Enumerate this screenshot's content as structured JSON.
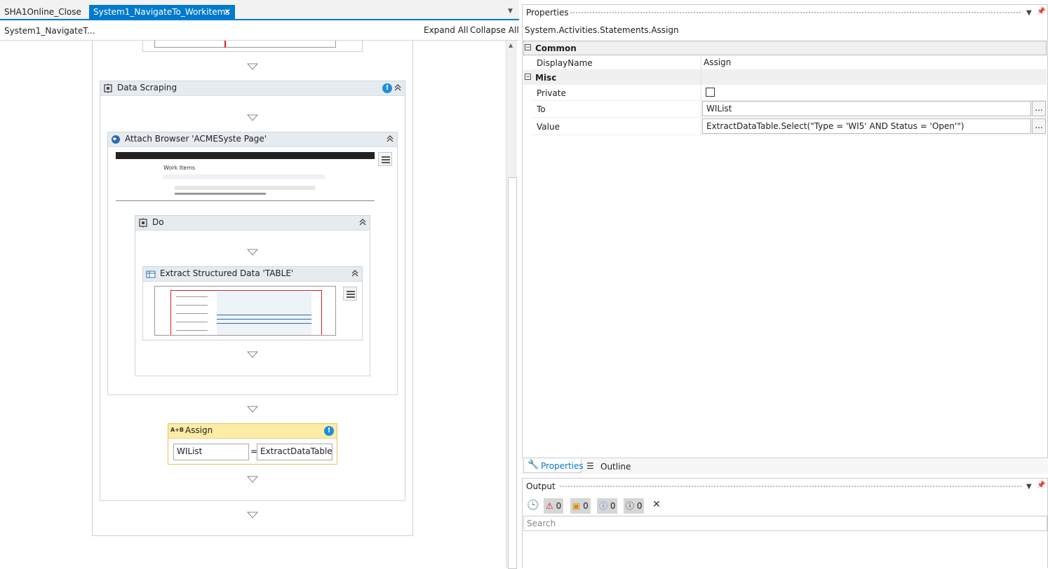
{
  "tabs": [
    {
      "label": "SHA1Online_Close",
      "active": false
    },
    {
      "label": "System1_NavigateTo_Workitems",
      "active": true
    }
  ],
  "breadcrumb": "System1_NavigateT...",
  "expand_all": "Expand All",
  "collapse_all": "Collapse All",
  "activities": {
    "data_scraping": "Data Scraping",
    "attach_browser": "Attach Browser 'ACMESyste Page'",
    "browser_preview_heading": "Work Items",
    "do": "Do",
    "extract": "Extract Structured Data 'TABLE'",
    "assign": "Assign",
    "assign_to": "WIList",
    "assign_equals": "=",
    "assign_value": "ExtractDataTable.Sel"
  },
  "properties": {
    "title": "Properties",
    "type_name": "System.Activities.Statements.Assign",
    "sections": [
      {
        "name": "Common",
        "props": [
          {
            "name": "DisplayName",
            "value": "Assign"
          }
        ]
      },
      {
        "name": "Misc",
        "props": [
          {
            "name": "Private",
            "value": ""
          },
          {
            "name": "To",
            "value": "WIList"
          },
          {
            "name": "Value",
            "value": "ExtractDataTable.Select(\"Type = 'WI5' AND Status = 'Open'\")"
          }
        ]
      }
    ],
    "ellipsis": "...",
    "bottom_tabs": [
      {
        "label": "Properties",
        "active": true
      },
      {
        "label": "Outline",
        "active": false
      }
    ]
  },
  "output": {
    "title": "Output",
    "counts": {
      "errors": "0",
      "warnings": "0",
      "info": "0",
      "trace": "0"
    },
    "search_placeholder": "Search"
  },
  "colors": {
    "accent": "#007acc",
    "assign_header": "#fdeca6",
    "warning_badge": "#1c8fdb"
  }
}
